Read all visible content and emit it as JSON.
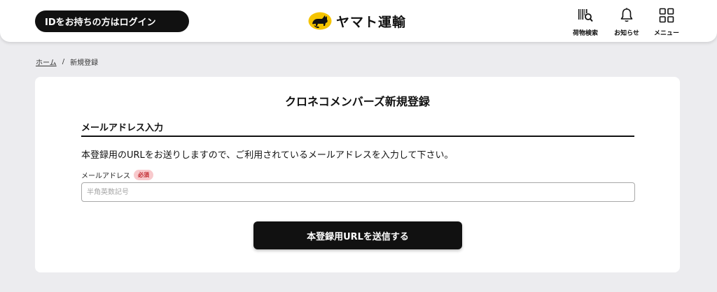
{
  "header": {
    "login_label": "IDをお持ちの方はログイン",
    "logo_text": "ヤマト運輸",
    "nav": [
      {
        "label": "荷物検索",
        "icon": "barcode-search-icon"
      },
      {
        "label": "お知らせ",
        "icon": "bell-icon"
      },
      {
        "label": "メニュー",
        "icon": "grid-menu-icon"
      }
    ]
  },
  "breadcrumb": {
    "home": "ホーム",
    "separator": "/",
    "current": "新規登録"
  },
  "form": {
    "title": "クロネコメンバーズ新規登録",
    "section_title": "メールアドレス入力",
    "description": "本登録用のURLをお送りしますので、ご利用されているメールアドレスを入力して下さい。",
    "email_label": "メールアドレス",
    "required_badge": "必須",
    "email_placeholder": "半角英数記号",
    "email_value": "",
    "submit_label": "本登録用URLを送信する"
  },
  "colors": {
    "brand_black": "#111111",
    "brand_yellow": "#f5c400",
    "page_bg": "#ececef",
    "required_bg": "#f8c9cc",
    "required_text": "#c0282e"
  }
}
